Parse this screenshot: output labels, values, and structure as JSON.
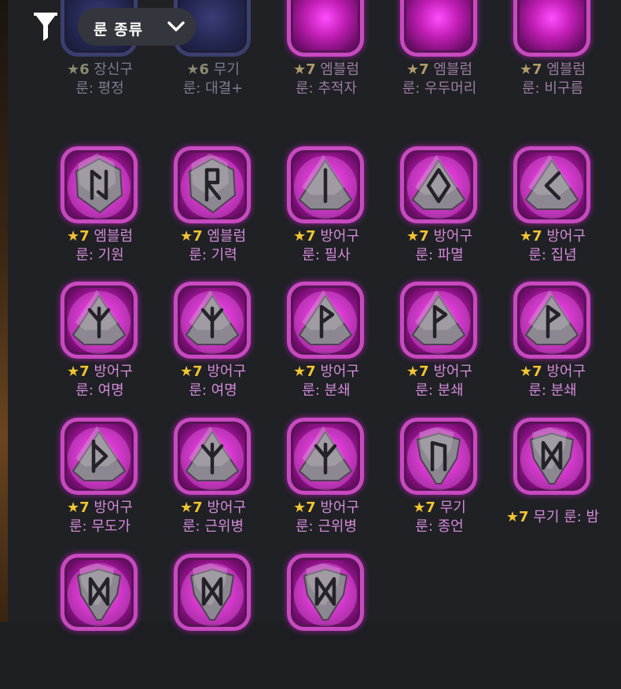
{
  "header": {
    "filter_icon": "filter-icon",
    "dropdown_label": "룬 종류",
    "dropdown_icon": "chevron-down-icon"
  },
  "colors": {
    "background": "#1f2125",
    "tile_magenta": "#c21fb6",
    "tile_blue": "#23264f",
    "caption": "#d58ad9",
    "star": "#f3c332"
  },
  "runes": [
    {
      "grade": "★6",
      "type": "장신구",
      "name_line": "룬: 평정",
      "symbol": "none",
      "theme": "blue"
    },
    {
      "grade": "★6",
      "type": "무기",
      "name_line": "룬: 대결+",
      "symbol": "none",
      "theme": "blue"
    },
    {
      "grade": "★7",
      "type": "엠블럼",
      "name_line": "룬: 추적자",
      "symbol": "none",
      "theme": "magenta"
    },
    {
      "grade": "★7",
      "type": "엠블럼",
      "name_line": "룬: 우두머리",
      "symbol": "none",
      "theme": "magenta"
    },
    {
      "grade": "★7",
      "type": "엠블럼",
      "name_line": "룬: 비구름",
      "symbol": "none",
      "theme": "magenta"
    },
    {
      "grade": "★7",
      "type": "엠블럼",
      "name_line": "룬: 기원",
      "symbol": "hex-jera",
      "theme": "magenta"
    },
    {
      "grade": "★7",
      "type": "엠블럼",
      "name_line": "룬: 기력",
      "symbol": "hex-raido",
      "theme": "magenta"
    },
    {
      "grade": "★7",
      "type": "방어구",
      "name_line": "룬: 필사",
      "symbol": "tri-isa",
      "theme": "magenta"
    },
    {
      "grade": "★7",
      "type": "방어구",
      "name_line": "룬: 파멸",
      "symbol": "tri-ingwaz",
      "theme": "magenta"
    },
    {
      "grade": "★7",
      "type": "방어구",
      "name_line": "룬: 집념",
      "symbol": "tri-kaunan",
      "theme": "magenta"
    },
    {
      "grade": "★7",
      "type": "방어구",
      "name_line": "룬: 여명",
      "symbol": "tri-algiz",
      "theme": "magenta"
    },
    {
      "grade": "★7",
      "type": "방어구",
      "name_line": "룬: 여명",
      "symbol": "tri-algiz",
      "theme": "magenta"
    },
    {
      "grade": "★7",
      "type": "방어구",
      "name_line": "룬: 분쇄",
      "symbol": "tri-wunjo",
      "theme": "magenta"
    },
    {
      "grade": "★7",
      "type": "방어구",
      "name_line": "룬: 분쇄",
      "symbol": "tri-wunjo",
      "theme": "magenta"
    },
    {
      "grade": "★7",
      "type": "방어구",
      "name_line": "룬: 분쇄",
      "symbol": "tri-wunjo",
      "theme": "magenta"
    },
    {
      "grade": "★7",
      "type": "방어구",
      "name_line": "룬: 무도가",
      "symbol": "tri-thurisaz",
      "theme": "magenta"
    },
    {
      "grade": "★7",
      "type": "방어구",
      "name_line": "룬: 근위병",
      "symbol": "tri-algiz",
      "theme": "magenta"
    },
    {
      "grade": "★7",
      "type": "방어구",
      "name_line": "룬: 근위병",
      "symbol": "tri-algiz",
      "theme": "magenta"
    },
    {
      "grade": "★7",
      "type": "무기",
      "name_line": "룬: 종언",
      "symbol": "shield-uruz",
      "theme": "magenta"
    },
    {
      "grade": "★7",
      "type": "무기 룬: 밤",
      "name_line": "",
      "symbol": "shield-dagaz",
      "theme": "magenta"
    },
    {
      "grade": "",
      "type": "",
      "name_line": "",
      "symbol": "shield-dagaz",
      "theme": "magenta"
    },
    {
      "grade": "",
      "type": "",
      "name_line": "",
      "symbol": "shield-dagaz",
      "theme": "magenta"
    },
    {
      "grade": "",
      "type": "",
      "name_line": "",
      "symbol": "shield-dagaz",
      "theme": "magenta"
    }
  ]
}
